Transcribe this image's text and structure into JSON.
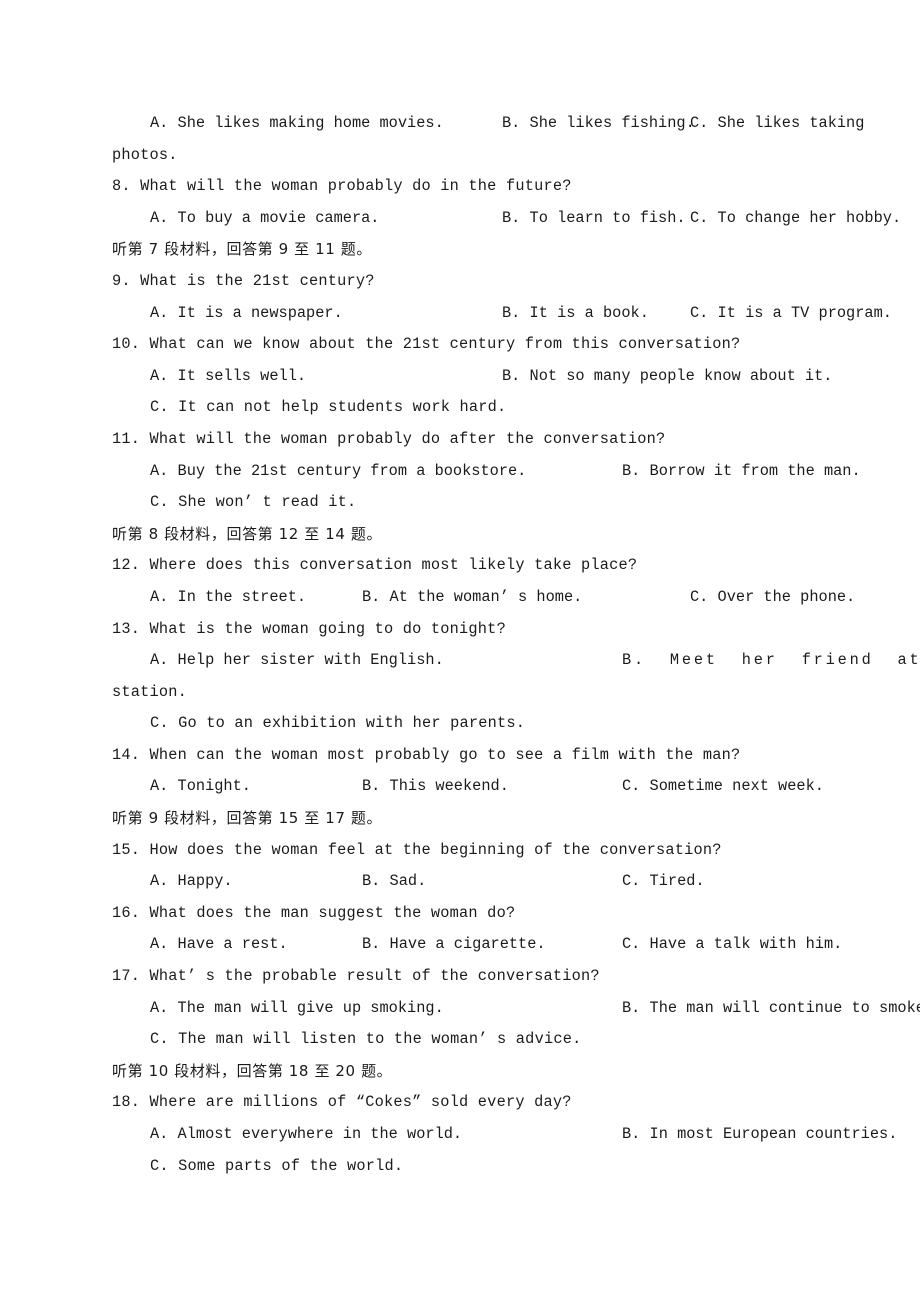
{
  "document": {
    "type": "english-listening-exam-page",
    "language": "en-zh"
  },
  "lines": [
    {
      "id": "q7-options",
      "kind": "option-row-3",
      "a": "A. She likes making home movies.",
      "b": "B. She likes fishing.",
      "c": "C. She likes taking"
    },
    {
      "id": "q7-wrap",
      "kind": "continuation",
      "text": "photos."
    },
    {
      "id": "q8-stem",
      "kind": "stem",
      "text": "8. What will the woman probably do in the future?"
    },
    {
      "id": "q8-options",
      "kind": "option-row-3",
      "a": "A. To buy a movie camera.",
      "b": "B. To learn to fish.",
      "c": "C. To change her hobby."
    },
    {
      "id": "heading-7",
      "kind": "chinese-heading",
      "text": "听第 7 段材料，回答第 9 至 11 题。"
    },
    {
      "id": "q9-stem",
      "kind": "stem",
      "text": "9. What is the 21st century?"
    },
    {
      "id": "q9-options",
      "kind": "option-row-3",
      "a": "A. It is a newspaper.",
      "b": "B. It is a book.",
      "c": "C. It is a TV program."
    },
    {
      "id": "q10-stem",
      "kind": "stem",
      "text": "10. What can we know about the 21st century from this conversation?"
    },
    {
      "id": "q10-options-ab",
      "kind": "option-row-2",
      "a": "A. It sells well.",
      "b": "B. Not so many people know about it."
    },
    {
      "id": "q10-option-c",
      "kind": "option-single",
      "text": "C. It can not help students work hard."
    },
    {
      "id": "q11-stem",
      "kind": "stem",
      "text": "11. What will the woman probably do after the conversation?"
    },
    {
      "id": "q11-options-ab",
      "kind": "option-row-2",
      "a": "A. Buy the 21st century from a bookstore.",
      "b": "B. Borrow it from the man."
    },
    {
      "id": "q11-option-c",
      "kind": "option-single",
      "text": "C. She won’ t read it."
    },
    {
      "id": "heading-8",
      "kind": "chinese-heading",
      "text": "听第 8 段材料，回答第 12 至 14 题。"
    },
    {
      "id": "q12-stem",
      "kind": "stem",
      "text": "12. Where does this conversation most likely take place?"
    },
    {
      "id": "q12-options",
      "kind": "option-row-3",
      "a": "A. In the street.",
      "b": "B. At the woman’ s home.",
      "c": "C. Over the phone."
    },
    {
      "id": "q13-stem",
      "kind": "stem",
      "text": "13. What is the woman going to do tonight?"
    },
    {
      "id": "q13-options-ab",
      "kind": "option-row-2-wide",
      "a": "A. Help her sister with English.",
      "b": "B.  Meet  her  friend  at  the"
    },
    {
      "id": "q13-wrap",
      "kind": "continuation",
      "text": "station."
    },
    {
      "id": "q13-option-c",
      "kind": "option-single",
      "text": "C. Go to an exhibition with her parents."
    },
    {
      "id": "q14-stem",
      "kind": "stem",
      "text": "14. When can the woman most probably go to see a film with the man?"
    },
    {
      "id": "q14-options",
      "kind": "option-row-3",
      "a": "A. Tonight.",
      "b": "B. This weekend.",
      "c": "C. Sometime next week."
    },
    {
      "id": "heading-9",
      "kind": "chinese-heading",
      "text": "听第 9 段材料，回答第 15 至 17 题。"
    },
    {
      "id": "q15-stem",
      "kind": "stem",
      "text": "15. How does the woman feel at the beginning of the conversation?"
    },
    {
      "id": "q15-options",
      "kind": "option-row-3",
      "a": "A. Happy.",
      "b": "B. Sad.",
      "c": "C. Tired."
    },
    {
      "id": "q16-stem",
      "kind": "stem",
      "text": "16. What does the man suggest the woman do?"
    },
    {
      "id": "q16-options",
      "kind": "option-row-3",
      "a": "A. Have a rest.",
      "b": "B. Have a cigarette.",
      "c": "C. Have a talk with him."
    },
    {
      "id": "q17-stem",
      "kind": "stem",
      "text": "17. What’ s the probable result of the conversation?"
    },
    {
      "id": "q17-options-ab",
      "kind": "option-row-2",
      "a": "A. The man will give up smoking.",
      "b": "B. The man will continue to smoke."
    },
    {
      "id": "q17-option-c",
      "kind": "option-single",
      "text": "C. The man will listen to the woman’ s advice."
    },
    {
      "id": "heading-10",
      "kind": "chinese-heading",
      "text": "听第 10 段材料，回答第 18 至 20 题。"
    },
    {
      "id": "q18-stem",
      "kind": "stem",
      "text": "18. Where are millions of “Cokes” sold every day?"
    },
    {
      "id": "q18-options-ab",
      "kind": "option-row-2",
      "a": "A. Almost everywhere in the world.",
      "b": "B. In most European countries."
    },
    {
      "id": "q18-option-c",
      "kind": "option-single",
      "text": "C. Some parts of the world."
    }
  ]
}
